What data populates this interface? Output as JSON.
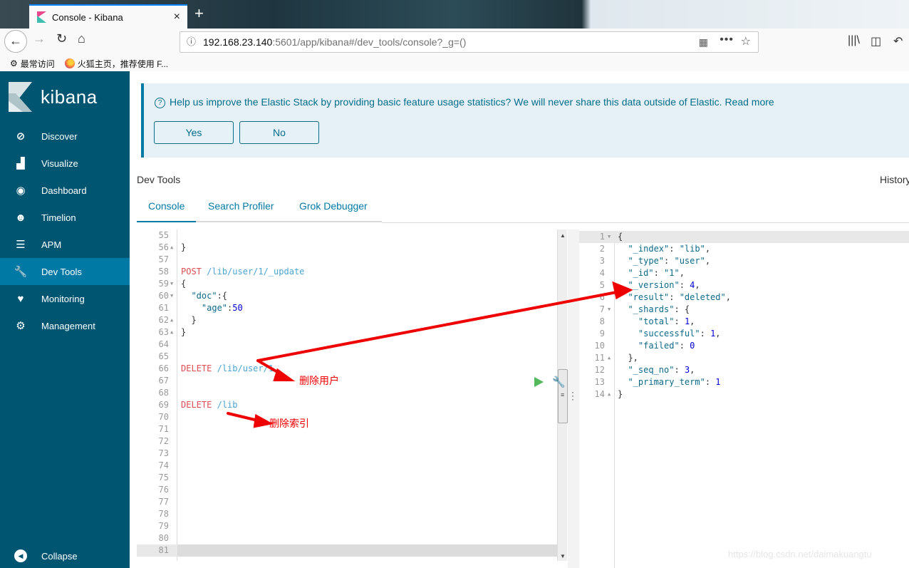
{
  "browser": {
    "tab_title": "Console - Kibana",
    "tab_close": "×",
    "new_tab": "+",
    "url_host": "192.168.23.140",
    "url_path": ":5601/app/kibana#/dev_tools/console?_g=()",
    "bookmarks": [
      {
        "icon": "gear-icon",
        "label": "最常访问"
      },
      {
        "icon": "firefox-icon",
        "label": "火狐主页，推荐使用 F..."
      }
    ]
  },
  "sidebar": {
    "brand": "kibana",
    "items": [
      {
        "label": "Discover",
        "icon": "compass-icon",
        "glyph": "⊘"
      },
      {
        "label": "Visualize",
        "icon": "bar-chart-icon",
        "glyph": "▟"
      },
      {
        "label": "Dashboard",
        "icon": "gauge-icon",
        "glyph": "◉"
      },
      {
        "label": "Timelion",
        "icon": "bear-icon",
        "glyph": "☻"
      },
      {
        "label": "APM",
        "icon": "apm-icon",
        "glyph": "☰"
      },
      {
        "label": "Dev Tools",
        "icon": "wrench-icon",
        "glyph": "🔧",
        "active": true
      },
      {
        "label": "Monitoring",
        "icon": "heartbeat-icon",
        "glyph": "♥"
      },
      {
        "label": "Management",
        "icon": "gear-icon",
        "glyph": "⚙"
      }
    ],
    "collapse": "Collapse"
  },
  "banner": {
    "message": "Help us improve the Elastic Stack by providing basic feature usage statistics? We will never share this data outside of Elastic. Read more",
    "yes": "Yes",
    "no": "No"
  },
  "devtools": {
    "title": "Dev Tools",
    "history": "History",
    "tabs": [
      "Console",
      "Search Profiler",
      "Grok Debugger"
    ],
    "active_tab": "Console"
  },
  "editor": {
    "lines": [
      {
        "n": "55",
        "fold": "",
        "code": []
      },
      {
        "n": "56",
        "fold": "▲",
        "code": [
          [
            "punc",
            "}"
          ]
        ]
      },
      {
        "n": "57",
        "fold": "",
        "code": []
      },
      {
        "n": "58",
        "fold": "",
        "code": [
          [
            "kw",
            "POST"
          ],
          [
            "punc",
            " "
          ],
          [
            "url-t",
            "/lib/user/1/_update"
          ]
        ]
      },
      {
        "n": "59",
        "fold": "▼",
        "code": [
          [
            "punc",
            "{"
          ]
        ]
      },
      {
        "n": "60",
        "fold": "▼",
        "code": [
          [
            "punc",
            "  "
          ],
          [
            "str",
            "\"doc\""
          ],
          [
            "punc",
            ":{"
          ]
        ]
      },
      {
        "n": "61",
        "fold": "",
        "code": [
          [
            "punc",
            "    "
          ],
          [
            "str",
            "\"age\""
          ],
          [
            "punc",
            ":"
          ],
          [
            "num",
            "50"
          ]
        ]
      },
      {
        "n": "62",
        "fold": "▲",
        "code": [
          [
            "punc",
            "  }"
          ]
        ]
      },
      {
        "n": "63",
        "fold": "▲",
        "code": [
          [
            "punc",
            "}"
          ]
        ]
      },
      {
        "n": "64",
        "fold": "",
        "code": []
      },
      {
        "n": "65",
        "fold": "",
        "code": []
      },
      {
        "n": "66",
        "fold": "",
        "code": [
          [
            "kw",
            "DELETE"
          ],
          [
            "punc",
            " "
          ],
          [
            "url-t",
            "/lib/user/1"
          ]
        ]
      },
      {
        "n": "67",
        "fold": "",
        "code": []
      },
      {
        "n": "68",
        "fold": "",
        "code": []
      },
      {
        "n": "69",
        "fold": "",
        "code": [
          [
            "kw",
            "DELETE"
          ],
          [
            "punc",
            " "
          ],
          [
            "url-t",
            "/lib"
          ]
        ]
      },
      {
        "n": "70",
        "fold": "",
        "code": []
      },
      {
        "n": "71",
        "fold": "",
        "code": []
      },
      {
        "n": "72",
        "fold": "",
        "code": []
      },
      {
        "n": "73",
        "fold": "",
        "code": []
      },
      {
        "n": "74",
        "fold": "",
        "code": []
      },
      {
        "n": "75",
        "fold": "",
        "code": []
      },
      {
        "n": "76",
        "fold": "",
        "code": []
      },
      {
        "n": "77",
        "fold": "",
        "code": []
      },
      {
        "n": "78",
        "fold": "",
        "code": []
      },
      {
        "n": "79",
        "fold": "",
        "code": []
      },
      {
        "n": "80",
        "fold": "",
        "code": []
      },
      {
        "n": "81",
        "fold": "",
        "code": [],
        "current": true
      }
    ]
  },
  "output": {
    "lines": [
      {
        "n": "1",
        "fold": "▼",
        "code": [
          [
            "punc",
            "{"
          ]
        ],
        "current": true
      },
      {
        "n": "2",
        "fold": "",
        "code": [
          [
            "punc",
            "  "
          ],
          [
            "str",
            "\"_index\""
          ],
          [
            "punc",
            ": "
          ],
          [
            "str",
            "\"lib\""
          ],
          [
            "punc",
            ","
          ]
        ]
      },
      {
        "n": "3",
        "fold": "",
        "code": [
          [
            "punc",
            "  "
          ],
          [
            "str",
            "\"_type\""
          ],
          [
            "punc",
            ": "
          ],
          [
            "str",
            "\"user\""
          ],
          [
            "punc",
            ","
          ]
        ]
      },
      {
        "n": "4",
        "fold": "",
        "code": [
          [
            "punc",
            "  "
          ],
          [
            "str",
            "\"_id\""
          ],
          [
            "punc",
            ": "
          ],
          [
            "str",
            "\"1\""
          ],
          [
            "punc",
            ","
          ]
        ]
      },
      {
        "n": "5",
        "fold": "",
        "code": [
          [
            "punc",
            "  "
          ],
          [
            "str",
            "\"_version\""
          ],
          [
            "punc",
            ": "
          ],
          [
            "num",
            "4"
          ],
          [
            "punc",
            ","
          ]
        ]
      },
      {
        "n": "6",
        "fold": "",
        "code": [
          [
            "punc",
            "  "
          ],
          [
            "str",
            "\"result\""
          ],
          [
            "punc",
            ": "
          ],
          [
            "str",
            "\"deleted\""
          ],
          [
            "punc",
            ","
          ]
        ]
      },
      {
        "n": "7",
        "fold": "▼",
        "code": [
          [
            "punc",
            "  "
          ],
          [
            "str",
            "\"_shards\""
          ],
          [
            "punc",
            ": {"
          ]
        ]
      },
      {
        "n": "8",
        "fold": "",
        "code": [
          [
            "punc",
            "    "
          ],
          [
            "str",
            "\"total\""
          ],
          [
            "punc",
            ": "
          ],
          [
            "num",
            "1"
          ],
          [
            "punc",
            ","
          ]
        ]
      },
      {
        "n": "9",
        "fold": "",
        "code": [
          [
            "punc",
            "    "
          ],
          [
            "str",
            "\"successful\""
          ],
          [
            "punc",
            ": "
          ],
          [
            "num",
            "1"
          ],
          [
            "punc",
            ","
          ]
        ]
      },
      {
        "n": "10",
        "fold": "",
        "code": [
          [
            "punc",
            "    "
          ],
          [
            "str",
            "\"failed\""
          ],
          [
            "punc",
            ": "
          ],
          [
            "num",
            "0"
          ]
        ]
      },
      {
        "n": "11",
        "fold": "▲",
        "code": [
          [
            "punc",
            "  },"
          ]
        ]
      },
      {
        "n": "12",
        "fold": "",
        "code": [
          [
            "punc",
            "  "
          ],
          [
            "str",
            "\"_seq_no\""
          ],
          [
            "punc",
            ": "
          ],
          [
            "num",
            "3"
          ],
          [
            "punc",
            ","
          ]
        ]
      },
      {
        "n": "13",
        "fold": "",
        "code": [
          [
            "punc",
            "  "
          ],
          [
            "str",
            "\"_primary_term\""
          ],
          [
            "punc",
            ": "
          ],
          [
            "num",
            "1"
          ]
        ]
      },
      {
        "n": "14",
        "fold": "▲",
        "code": [
          [
            "punc",
            "}"
          ]
        ]
      }
    ]
  },
  "annotations": {
    "delete_user": "删除用户",
    "delete_index": "删除索引"
  },
  "watermark": "https://blog.csdn.net/daimakuangtu",
  "colors": {
    "sidebar_bg": "#005571",
    "sidebar_active": "#0079a5",
    "accent": "#0079a5",
    "annotation": "#ee0000"
  }
}
